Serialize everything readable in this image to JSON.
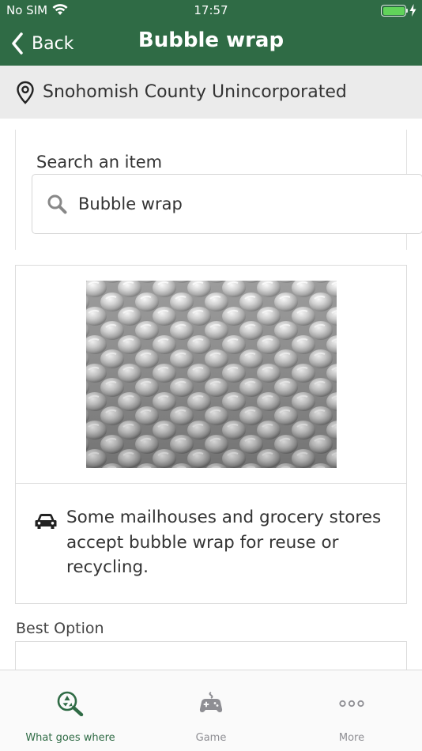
{
  "status_bar": {
    "carrier": "No SIM",
    "time": "17:57",
    "icons": [
      "wifi-icon",
      "battery-icon",
      "charging-bolt-icon"
    ]
  },
  "nav": {
    "back_label": "Back",
    "title": "Bubble wrap",
    "back_icon": "chevron-left-icon"
  },
  "location": {
    "label": "Snohomish County Unincorporated",
    "icon": "location-pin-icon"
  },
  "search": {
    "title": "Search an item",
    "value": "Bubble wrap",
    "icon": "search-icon"
  },
  "item": {
    "image_icon": "bubble-wrap-photo",
    "note": "Some mailhouses and grocery stores accept bubble wrap for reuse or recycling.",
    "note_icon": "car-icon"
  },
  "best_option": {
    "label": "Best Option"
  },
  "tabs": [
    {
      "label": "What goes where",
      "icon": "recycle-search-icon",
      "active": true
    },
    {
      "label": "Game",
      "icon": "game-controller-icon",
      "active": false
    },
    {
      "label": "More",
      "icon": "more-dots-icon",
      "active": false
    }
  ],
  "colors": {
    "primary": "#2f6b45",
    "location_bar": "#ebebeb",
    "tab_inactive": "#8e8e93",
    "battery": "#61d35a"
  }
}
